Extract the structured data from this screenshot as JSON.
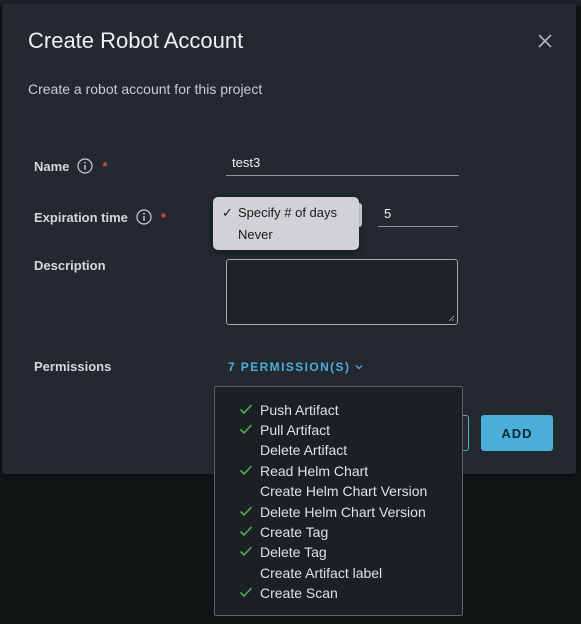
{
  "modal": {
    "title": "Create Robot Account",
    "subtitle": "Create a robot account for this project"
  },
  "form": {
    "name_label": "Name",
    "name_value": "test3",
    "expiration_label": "Expiration time",
    "expiration_options": [
      {
        "label": "Specify # of days",
        "selected": true
      },
      {
        "label": "Never",
        "selected": false
      }
    ],
    "expiration_days": "5",
    "description_label": "Description",
    "description_value": "",
    "permissions_label": "Permissions",
    "permissions_toggle": "7 PERMISSION(S)",
    "required_mark": "*"
  },
  "buttons": {
    "add_label": "ADD"
  },
  "permissions": [
    {
      "label": "Push Artifact",
      "checked": true
    },
    {
      "label": "Pull Artifact",
      "checked": true
    },
    {
      "label": "Delete Artifact",
      "checked": false
    },
    {
      "label": "Read Helm Chart",
      "checked": true
    },
    {
      "label": "Create Helm Chart Version",
      "checked": false
    },
    {
      "label": "Delete Helm Chart Version",
      "checked": true
    },
    {
      "label": "Create Tag",
      "checked": true
    },
    {
      "label": "Delete Tag",
      "checked": true
    },
    {
      "label": "Create Artifact label",
      "checked": false
    },
    {
      "label": "Create Scan",
      "checked": true
    }
  ],
  "icons": {
    "close": "close-icon",
    "info": "info-icon",
    "check": "check-icon",
    "chevron": "chevron-down-icon"
  },
  "colors": {
    "accent": "#4aaed9",
    "required": "#e04848",
    "check": "#4caf50",
    "modal_bg": "#23292e"
  }
}
